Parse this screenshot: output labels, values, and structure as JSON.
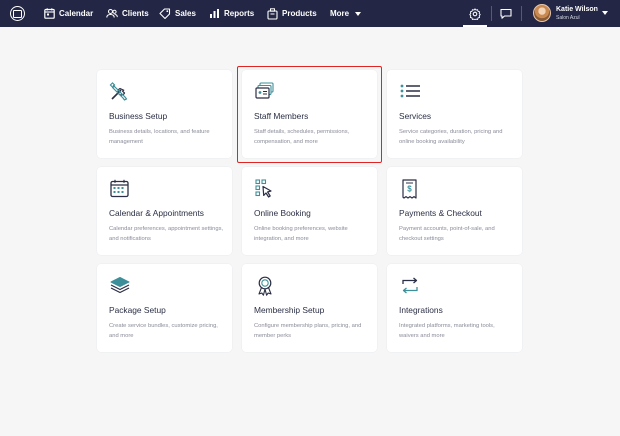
{
  "nav": {
    "items": [
      {
        "label": "Calendar",
        "icon": "calendar-icon"
      },
      {
        "label": "Clients",
        "icon": "clients-icon"
      },
      {
        "label": "Sales",
        "icon": "tag-icon"
      },
      {
        "label": "Reports",
        "icon": "bar-chart-icon"
      },
      {
        "label": "Products",
        "icon": "products-icon"
      },
      {
        "label": "More",
        "icon": "chevron-down-icon"
      }
    ],
    "user": {
      "name": "Katie Wilson",
      "subtitle": "Salon Azul"
    }
  },
  "cards": [
    {
      "title": "Business Setup",
      "description": "Business details, locations, and feature management",
      "icon": "tools-icon"
    },
    {
      "title": "Staff Members",
      "description": "Staff details, schedules, permissions, compensation, and more",
      "icon": "staff-badges-icon"
    },
    {
      "title": "Services",
      "description": "Service categories, duration, pricing and online booking availability",
      "icon": "list-icon"
    },
    {
      "title": "Calendar & Appointments",
      "description": "Calendar preferences, appointment settings, and notifications",
      "icon": "calendar-grid-icon"
    },
    {
      "title": "Online Booking",
      "description": "Online booking preferences, website integration, and more",
      "icon": "cursor-grid-icon"
    },
    {
      "title": "Payments & Checkout",
      "description": "Payment accounts, point-of-sale, and checkout settings",
      "icon": "receipt-icon"
    },
    {
      "title": "Package Setup",
      "description": "Create service bundles, customize pricing, and more",
      "icon": "layers-icon"
    },
    {
      "title": "Membership Setup",
      "description": "Configure membership plans, pricing, and member perks",
      "icon": "award-icon"
    },
    {
      "title": "Integrations",
      "description": "Integrated platforms, marketing tools, waivers and more",
      "icon": "sync-icon"
    }
  ],
  "colors": {
    "topbar": "#232644",
    "icon_teal": "#3d8f9a",
    "icon_dark": "#2b2f45",
    "highlight": "#e02424"
  }
}
